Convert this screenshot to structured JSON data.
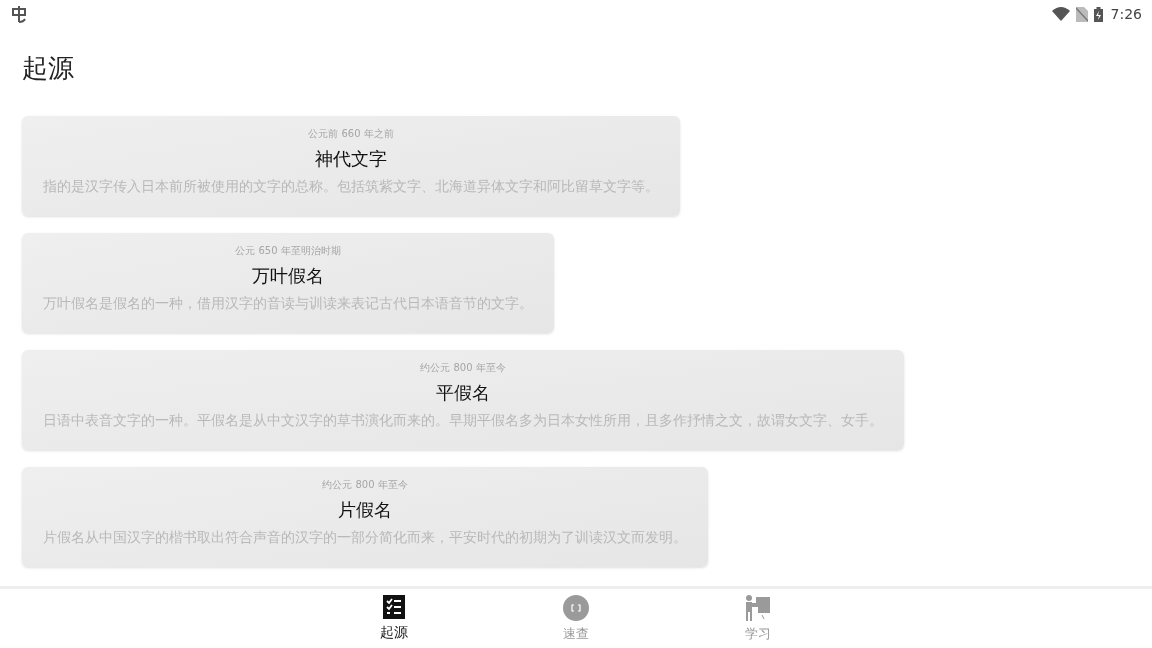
{
  "status_bar": {
    "time": "7:26"
  },
  "page": {
    "title": "起源"
  },
  "cards": [
    {
      "date": "公元前 660 年之前",
      "title": "神代文字",
      "description": "指的是汉字传入日本前所被使用的文字的总称。包括筑紫文字、北海道异体文字和阿比留草文字等。"
    },
    {
      "date": "公元 650 年至明治时期",
      "title": "万叶假名",
      "description": "万叶假名是假名的一种，借用汉字的音读与训读来表记古代日本语音节的文字。"
    },
    {
      "date": "约公元 800 年至今",
      "title": "平假名",
      "description": "日语中表音文字的一种。平假名是从中文汉字的草书演化而来的。早期平假名多为日本女性所用，且多作抒情之文，故谓女文字、女手。"
    },
    {
      "date": "约公元 800 年至今",
      "title": "片假名",
      "description": "片假名从中国汉字的楷书取出符合声音的汉字的一部分简化而来，平安时代的初期为了训读汉文而发明。"
    }
  ],
  "bottom_nav": [
    {
      "kind": "list",
      "label": "起源",
      "selected": true
    },
    {
      "kind": "circle",
      "label": "速查",
      "selected": false
    },
    {
      "kind": "teacher",
      "label": "学习",
      "selected": false
    }
  ]
}
